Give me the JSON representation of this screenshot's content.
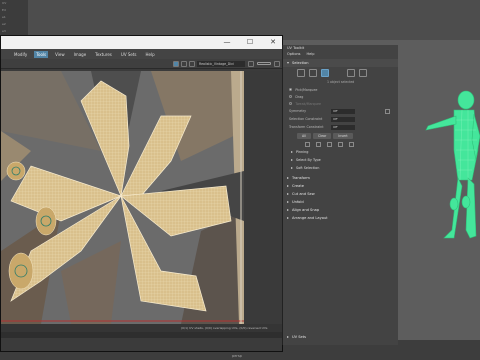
{
  "left_panel": {
    "rows": [
      "UV",
      "Ed",
      "e1",
      "e2",
      "e3",
      "e4"
    ]
  },
  "uv_editor": {
    "window_controls": {
      "minimize": "—",
      "maximize": "☐",
      "close": "✕"
    },
    "menu": [
      "",
      "Modify",
      "Tools",
      "View",
      "Image",
      "Textures",
      "UV Sets",
      "Help"
    ],
    "active_menu_index": 2,
    "texture_field": "Realistic_Vintage_Divi",
    "status_text": "(0/1) UV shells, (0/0) overlapping UVs, (0/0) reversed UVs",
    "bottom_label": "UV Sets"
  },
  "uv_toolkit": {
    "title": "UV Toolkit",
    "menu": [
      "Options",
      "Help"
    ],
    "selection_section": "Selection",
    "selected_info": "1 object selected",
    "pick_modes": [
      "Pick/Marquee",
      "Drag",
      "Tweak/Marquee"
    ],
    "symmetry_label": "Symmetry",
    "symmetry_value": "Off",
    "selection_constraint_label": "Selection Constraint",
    "selection_constraint_value": "Off",
    "transform_constraint_label": "Transform Constraint",
    "transform_constraint_value": "Off",
    "buttons": [
      "All",
      "Clear",
      "Invert"
    ],
    "sub_sections": [
      "Pinning",
      "Select By Type",
      "Soft Selection"
    ],
    "sections": [
      "Transform",
      "Create",
      "Cut and Sew",
      "Unfold",
      "Align and Snap",
      "Arrange and Layout"
    ]
  },
  "viewport_footer": "persp",
  "colors": {
    "accent": "#5285a6",
    "uv_lines": "#f4e6c4",
    "character": "#40e89a"
  }
}
